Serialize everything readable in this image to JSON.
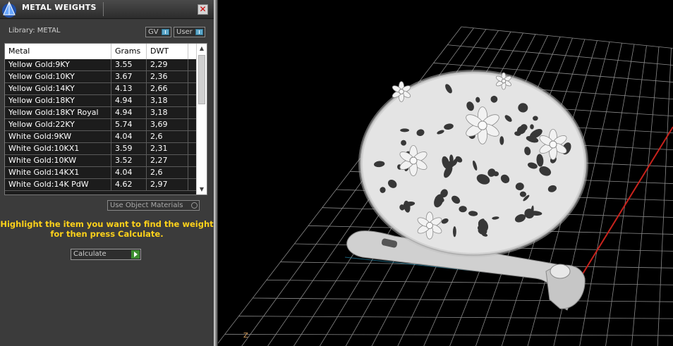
{
  "panel": {
    "title": "METAL WEIGHTS",
    "close_glyph": "✕",
    "library_label": "Library: METAL",
    "toggles": {
      "gv": "GV",
      "user": "User"
    },
    "table": {
      "columns": [
        "Metal",
        "Grams",
        "DWT"
      ],
      "rows": [
        {
          "metal": "Yellow Gold:9KY",
          "grams": "3.55",
          "dwt": "2,29"
        },
        {
          "metal": "Yellow Gold:10KY",
          "grams": "3.67",
          "dwt": "2,36"
        },
        {
          "metal": "Yellow Gold:14KY",
          "grams": "4.13",
          "dwt": "2,66"
        },
        {
          "metal": "Yellow Gold:18KY",
          "grams": "4.94",
          "dwt": "3,18"
        },
        {
          "metal": "Yellow Gold:18KY Royal",
          "grams": "4.94",
          "dwt": "3,18"
        },
        {
          "metal": "Yellow Gold:22KY",
          "grams": "5.74",
          "dwt": "3,69"
        },
        {
          "metal": "White Gold:9KW",
          "grams": "4.04",
          "dwt": "2,6"
        },
        {
          "metal": "White Gold:10KX1",
          "grams": "3.59",
          "dwt": "2,31"
        },
        {
          "metal": "White Gold:10KW",
          "grams": "3.52",
          "dwt": "2,27"
        },
        {
          "metal": "White Gold:14KX1",
          "grams": "4.04",
          "dwt": "2,6"
        },
        {
          "metal": "White Gold:14K PdW",
          "grams": "4.62",
          "dwt": "2,97"
        }
      ]
    },
    "use_object_materials": "Use Object Materials",
    "hint_line1": "Highlight the item you want to find the weight",
    "hint_line2": "for then press Calculate.",
    "calculate_label": "Calculate"
  },
  "viewport": {
    "axis_label": "Z",
    "colors": {
      "grid": "#8a8a8a",
      "red_axis": "#c8221c",
      "model": "#d9d9d9"
    }
  }
}
